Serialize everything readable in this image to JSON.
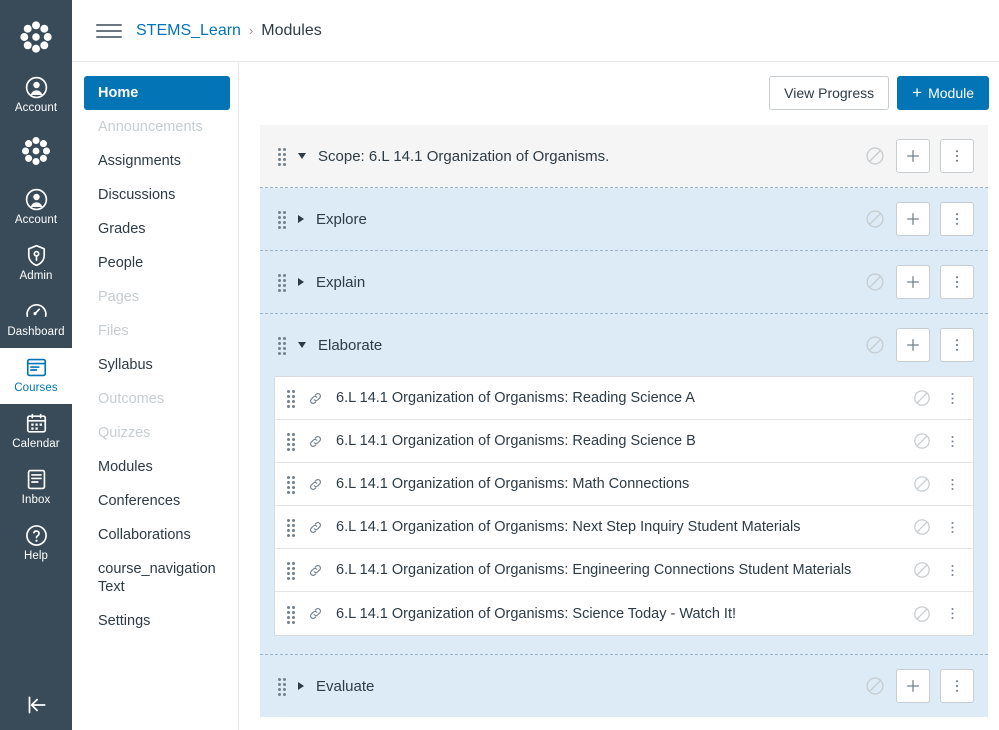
{
  "global_nav": {
    "logo_icon": "canvas-logo-icon",
    "items": [
      {
        "label": "Account",
        "icon": "account-avatar-icon",
        "active": false
      },
      {
        "label": "",
        "icon": "canvas-logo-icon",
        "active": false
      },
      {
        "label": "Account",
        "icon": "account-avatar-icon",
        "active": false
      },
      {
        "label": "Admin",
        "icon": "admin-shield-icon",
        "active": false
      },
      {
        "label": "Dashboard",
        "icon": "dashboard-speedometer-icon",
        "active": false
      },
      {
        "label": "Courses",
        "icon": "courses-book-icon",
        "active": true
      },
      {
        "label": "Calendar",
        "icon": "calendar-icon",
        "active": false
      },
      {
        "label": "Inbox",
        "icon": "inbox-icon",
        "active": false
      },
      {
        "label": "Help",
        "icon": "help-question-icon",
        "active": false
      }
    ],
    "collapse_icon": "collapse-left-arrow-icon"
  },
  "breadcrumb": {
    "menu_icon": "hamburger-menu-icon",
    "course": "STEMS_Learn",
    "separator": "›",
    "current": "Modules"
  },
  "course_nav": {
    "items": [
      {
        "label": "Home",
        "state": "active"
      },
      {
        "label": "Announcements",
        "state": "disabled"
      },
      {
        "label": "Assignments",
        "state": "normal"
      },
      {
        "label": "Discussions",
        "state": "normal"
      },
      {
        "label": "Grades",
        "state": "normal"
      },
      {
        "label": "People",
        "state": "normal"
      },
      {
        "label": "Pages",
        "state": "disabled"
      },
      {
        "label": "Files",
        "state": "disabled"
      },
      {
        "label": "Syllabus",
        "state": "normal"
      },
      {
        "label": "Outcomes",
        "state": "disabled"
      },
      {
        "label": "Quizzes",
        "state": "disabled"
      },
      {
        "label": "Modules",
        "state": "normal"
      },
      {
        "label": "Conferences",
        "state": "normal"
      },
      {
        "label": "Collaborations",
        "state": "normal"
      },
      {
        "label": "course_navigation Text",
        "state": "normal"
      },
      {
        "label": "Settings",
        "state": "normal"
      }
    ]
  },
  "toolbar": {
    "view_progress_label": "View Progress",
    "add_module_label": "Module",
    "add_module_plus": "+"
  },
  "modules": [
    {
      "title": "Scope: 6.L 14.1 Organization of Organisms.",
      "expanded": true,
      "tone": "grey",
      "publish_state_icon": "unpublished-no-symbol-icon",
      "add_icon": "plus-icon",
      "menu_icon": "kebab-menu-icon",
      "items": []
    },
    {
      "title": "Explore",
      "expanded": false,
      "tone": "blue",
      "publish_state_icon": "unpublished-no-symbol-icon",
      "add_icon": "plus-icon",
      "menu_icon": "kebab-menu-icon",
      "items": []
    },
    {
      "title": "Explain",
      "expanded": false,
      "tone": "blue",
      "publish_state_icon": "unpublished-no-symbol-icon",
      "add_icon": "plus-icon",
      "menu_icon": "kebab-menu-icon",
      "items": []
    },
    {
      "title": "Elaborate",
      "expanded": true,
      "tone": "blue",
      "publish_state_icon": "unpublished-no-symbol-icon",
      "add_icon": "plus-icon",
      "menu_icon": "kebab-menu-icon",
      "items": [
        {
          "title": "6.L 14.1 Organization of Organisms: Reading Science A",
          "type_icon": "link-icon",
          "publish_state_icon": "unpublished-no-symbol-icon",
          "menu_icon": "kebab-menu-icon"
        },
        {
          "title": "6.L 14.1 Organization of Organisms: Reading Science B",
          "type_icon": "link-icon",
          "publish_state_icon": "unpublished-no-symbol-icon",
          "menu_icon": "kebab-menu-icon"
        },
        {
          "title": "6.L 14.1 Organization of Organisms: Math Connections",
          "type_icon": "link-icon",
          "publish_state_icon": "unpublished-no-symbol-icon",
          "menu_icon": "kebab-menu-icon"
        },
        {
          "title": "6.L 14.1 Organization of Organisms: Next Step Inquiry Student Materials",
          "type_icon": "link-icon",
          "publish_state_icon": "unpublished-no-symbol-icon",
          "menu_icon": "kebab-menu-icon"
        },
        {
          "title": "6.L 14.1 Organization of Organisms: Engineering Connections Student Materials",
          "type_icon": "link-icon",
          "publish_state_icon": "unpublished-no-symbol-icon",
          "menu_icon": "kebab-menu-icon"
        },
        {
          "title": "6.L 14.1 Organization of Organisms: Science Today - Watch It!",
          "type_icon": "link-icon",
          "publish_state_icon": "unpublished-no-symbol-icon",
          "menu_icon": "kebab-menu-icon"
        }
      ]
    },
    {
      "title": "Evaluate",
      "expanded": false,
      "tone": "blue",
      "publish_state_icon": "unpublished-no-symbol-icon",
      "add_icon": "plus-icon",
      "menu_icon": "kebab-menu-icon",
      "items": []
    }
  ],
  "colors": {
    "brand_blue": "#0374B5",
    "nav_dark": "#394B58",
    "module_blue": "#DCEBF5",
    "module_grey": "#F5F5F5",
    "text_dark": "#2D3B45",
    "disabled_grey": "#C7CDD1"
  }
}
